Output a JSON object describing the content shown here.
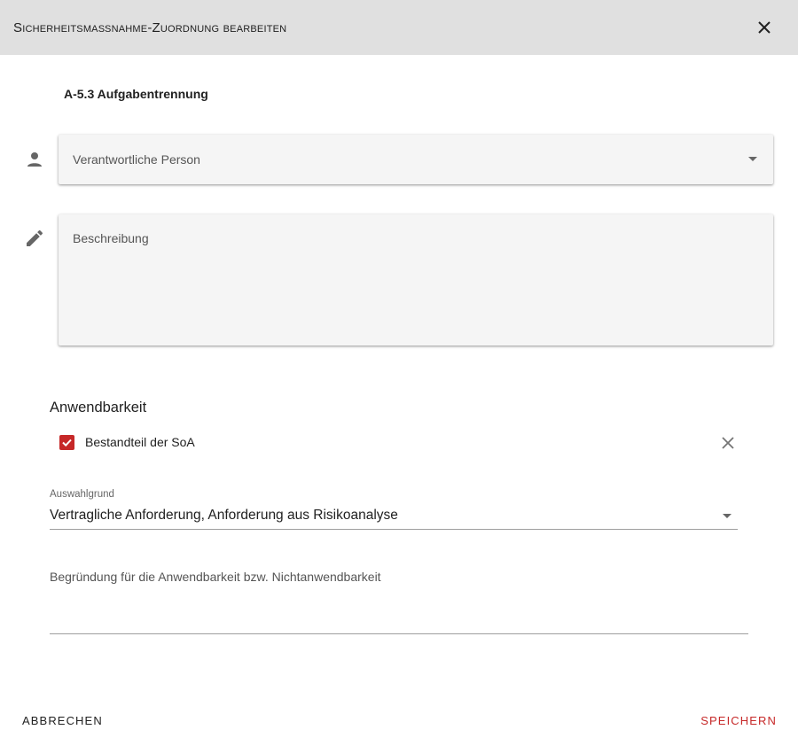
{
  "dialog": {
    "title": "Sicherheitsmaßnahme-Zuordnung bearbeiten",
    "close_icon": "close-icon"
  },
  "measure": {
    "title": "A-5.3 Aufgabentrennung"
  },
  "responsible": {
    "label": "Verantwortliche Person",
    "icon": "person-icon"
  },
  "description": {
    "label": "Beschreibung",
    "icon": "pencil-icon"
  },
  "applicability": {
    "section_title": "Anwendbarkeit",
    "checkbox_label": "Bestandteil der SoA",
    "checkbox_checked": true,
    "accent_color": "#c62828"
  },
  "selection_reason": {
    "caption": "Auswahlgrund",
    "value": "Vertragliche Anforderung, Anforderung aus Risikoanalyse"
  },
  "justification": {
    "label": "Begründung für die Anwendbarkeit bzw. Nichtanwendbarkeit"
  },
  "actions": {
    "cancel_label": "ABBRECHEN",
    "save_label": "SPEICHERN"
  }
}
